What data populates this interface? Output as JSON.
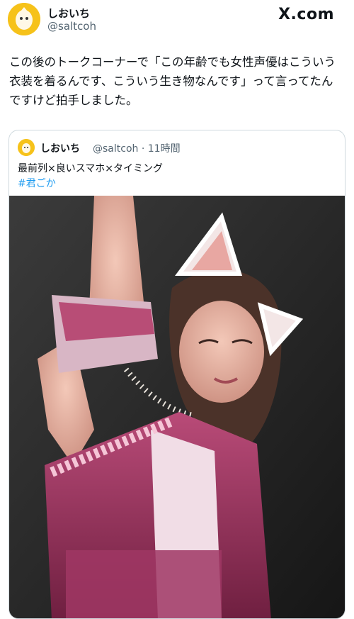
{
  "brand": "X.com",
  "author": {
    "name": "しおいち",
    "handle": "@saltcoh"
  },
  "tweet": {
    "lines": [
      "この後のトークコーナーで「この年齢でも女性声優はこういう",
      "衣装を着るんです、こういう生き物なんです」って言ってたん",
      "ですけど拍手しました。"
    ]
  },
  "quote": {
    "name": "しおいち",
    "handle": "@saltcoh",
    "time": "11時間",
    "text": "最前列×良いスマホ×タイミング",
    "hashtag": "#君ごか"
  },
  "icons": {
    "avatar": "avatar-icon",
    "brand": "x-logo-icon"
  },
  "colors": {
    "accent": "#1d9bf0",
    "avatar_bg": "#f6c21a"
  }
}
